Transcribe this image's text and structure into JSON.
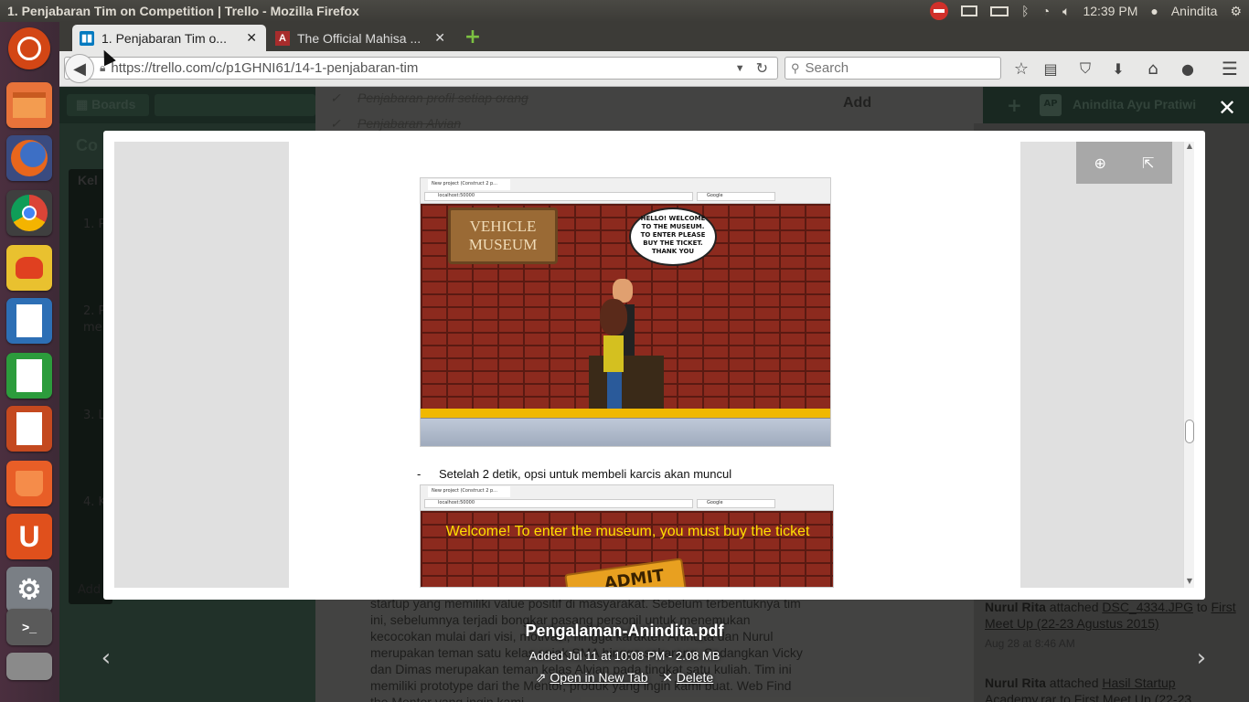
{
  "window": {
    "title": "1. Penjabaran Tim on Competition | Trello - Mozilla Firefox"
  },
  "tray": {
    "time": "12:39 PM",
    "user": "Anindita"
  },
  "tabs": [
    {
      "label": "1. Penjabaran Tim o...",
      "icon": "trello-icon"
    },
    {
      "label": "The Official Mahisa ...",
      "icon": "a-letter-icon"
    }
  ],
  "nav": {
    "url": "https://trello.com/c/p1GHNI61/14-1-penjabaran-tim",
    "search_placeholder": "Search"
  },
  "trello": {
    "boards_label": "Boards",
    "checklist": [
      "Penjabaran profil setiap orang",
      "Penjabaran Alvian"
    ],
    "add_heading": "Add",
    "user_initials": "AP",
    "user_name": "Anindita Ayu Pratiwi",
    "board_title": "Co",
    "list_title": "Kel",
    "cards": [
      "1. P",
      "2. P",
      "3. L",
      "4. K"
    ],
    "card_extra": "me",
    "add_card": "Add",
    "description": "startup yang memiliki value positif di masyarakat. Sebelum terbentuknya tim ini, sebelumnya terjadi bongkar pasang personil untuk menemukan kecocokan mulai dari visi, motivasi, hingga karakter. Anindita dan Nurul merupakan teman satu kelas sejak SMA hingga sekarang. Sedangkan Vicky dan Dimas merupakan teman kelas Alvian pada tingkat satu kuliah. Tim ini memiliki prototype dari the Mentor, produk yang ingin kami buat. Web Find the Mentor yang ingin kami",
    "activity": [
      {
        "user": "Nurul Rita",
        "action": "attached",
        "file": "DSC_4334.JPG",
        "to": "to",
        "target": "First Meet Up (22-23 Agustus 2015)",
        "time": "Aug 28 at 8:46 AM"
      },
      {
        "user": "Nurul Rita",
        "action": "attached",
        "file": "Hasil Startup Academy.rar",
        "to": "to",
        "target": "First Meet Up (22-23",
        "time": ""
      }
    ]
  },
  "doc": {
    "shot1_speech": "HELLO! WELCOME TO THE MUSEUM. TO ENTER PLEASE BUY THE TICKET. THANK YOU",
    "shot1_sign": "VEHICLE MUSEUM",
    "bullet_dash": "-",
    "bullet": "Setelah 2 detik, opsi untuk membeli karcis akan muncul",
    "shot2_banner": "Welcome! To enter the museum, you must buy the ticket",
    "shot2_ticket": "ADMIT",
    "shot_tab": "New project (Construct 2 p...",
    "shot_url": "localhost:50000",
    "shot_search": "Google"
  },
  "attachment": {
    "filename": "Pengalaman-Anindita.pdf",
    "meta": "Added Jul 11 at 10:08 PM - 2.08 MB",
    "open_label": "Open in New Tab",
    "delete_label": "Delete"
  },
  "colors": {
    "ubuntu_panel": "#3c3b37",
    "launcher": "#4b2f3f",
    "trello_green": "#3c5a4b",
    "brick": "#8c2a1e",
    "ticket_yellow": "#ffd700"
  }
}
